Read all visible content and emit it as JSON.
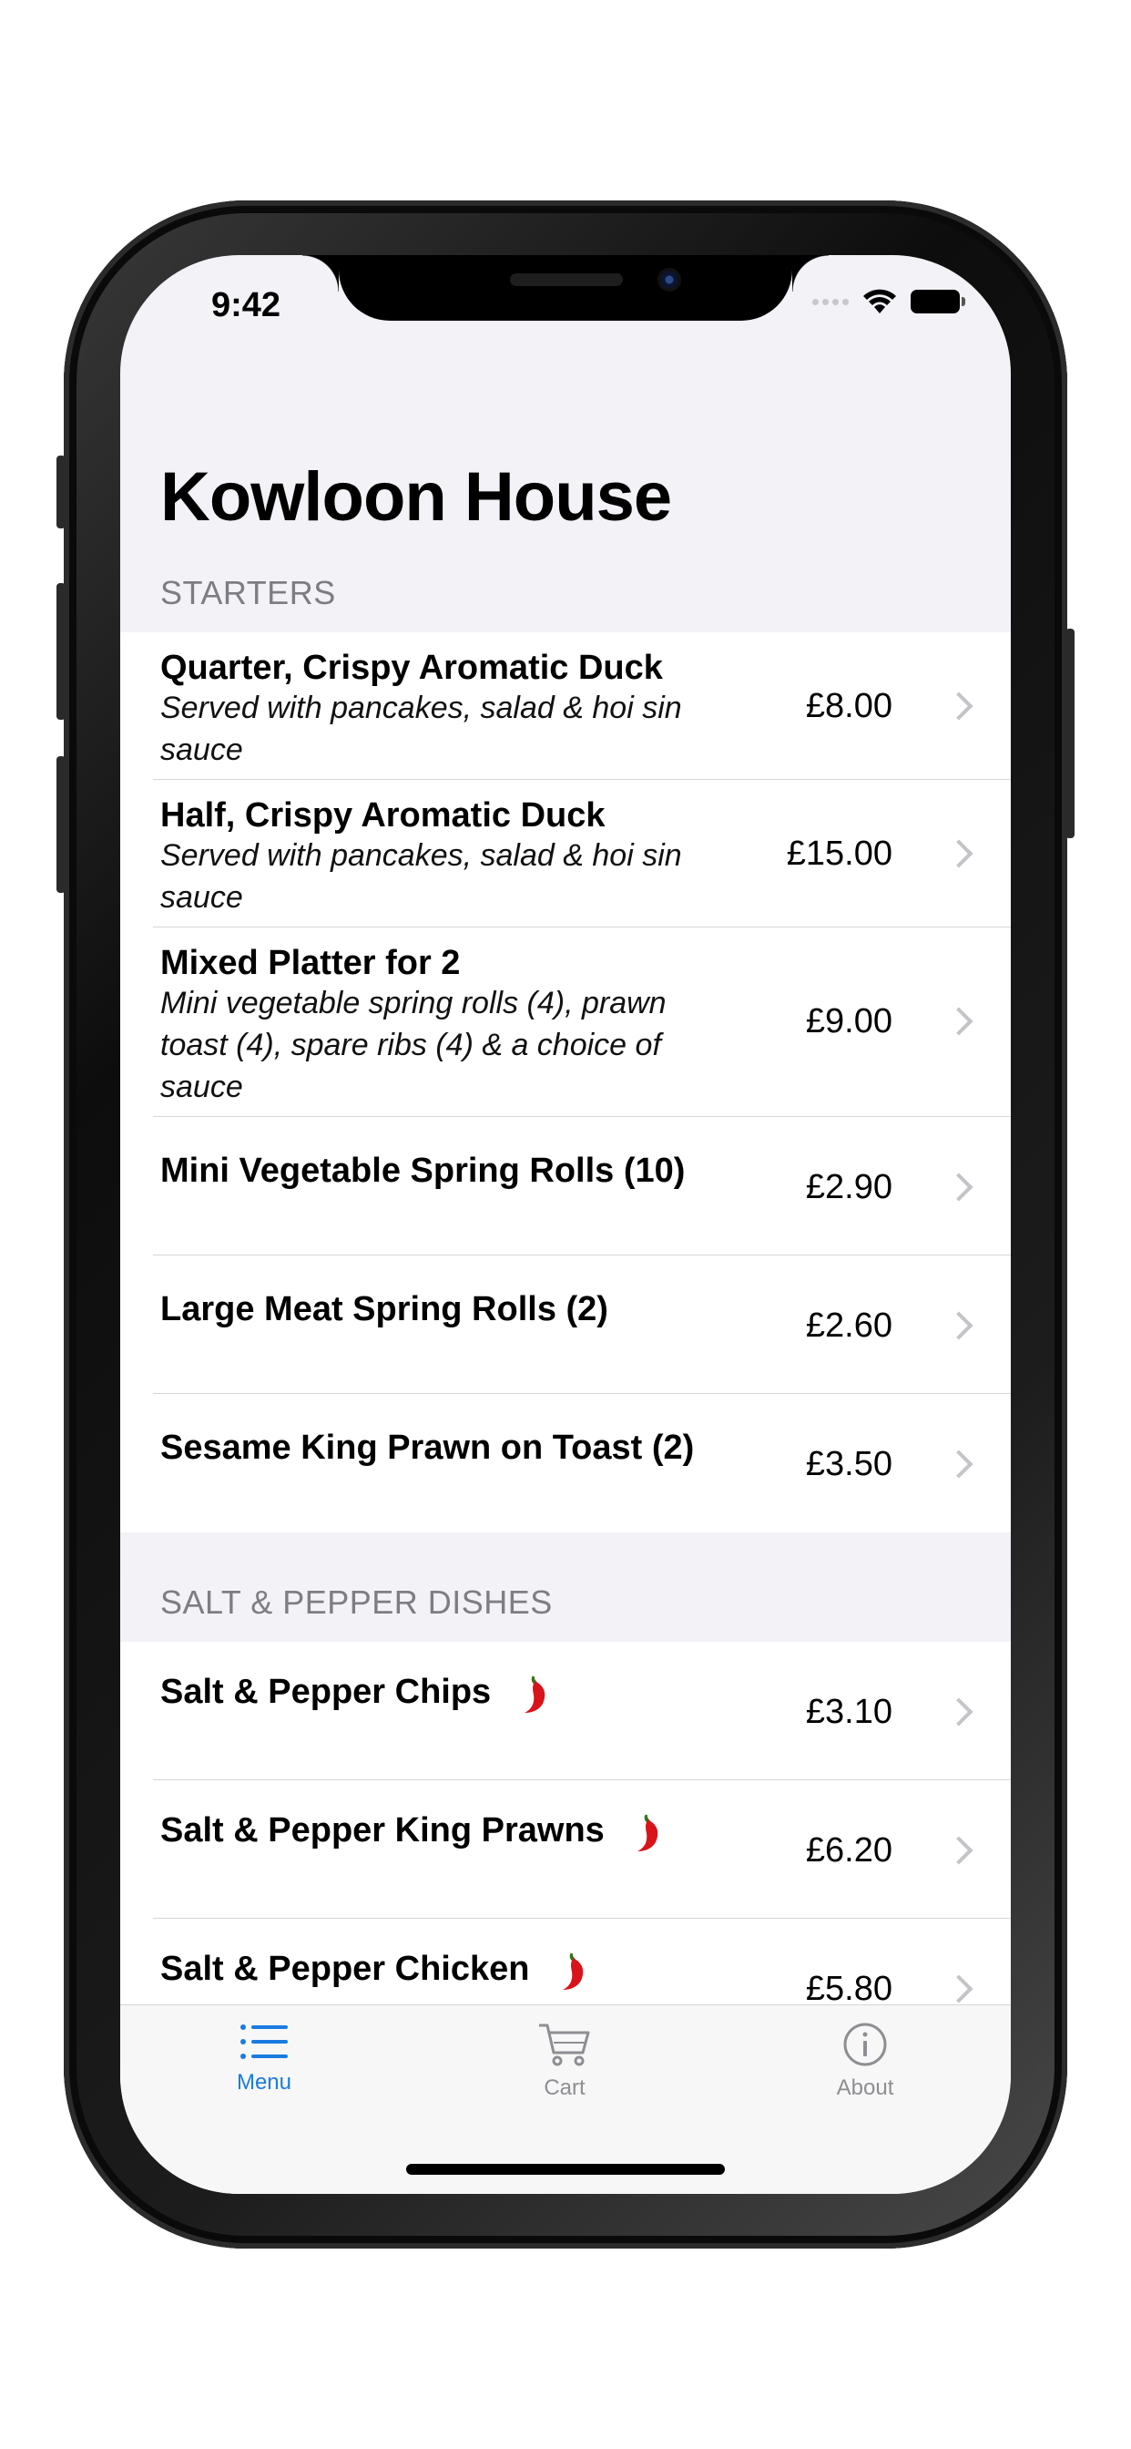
{
  "status": {
    "time": "9:42"
  },
  "title": "Kowloon House",
  "sections": [
    {
      "header": "STARTERS",
      "items": [
        {
          "name": "Quarter, Crispy Aromatic Duck",
          "description": "Served with pancakes, salad & hoi sin sauce",
          "price": "£8.00"
        },
        {
          "name": "Half, Crispy Aromatic Duck",
          "description": "Served with pancakes, salad & hoi sin sauce",
          "price": "£15.00"
        },
        {
          "name": "Mixed Platter for 2",
          "description": "Mini vegetable spring rolls (4), prawn toast (4), spare ribs (4) & a choice of sauce",
          "price": "£9.00"
        },
        {
          "name": "Mini Vegetable Spring Rolls (10)",
          "description": "",
          "price": "£2.90"
        },
        {
          "name": "Large Meat Spring Rolls (2)",
          "description": "",
          "price": "£2.60"
        },
        {
          "name": "Sesame King Prawn on Toast (2)",
          "description": "",
          "price": "£3.50"
        }
      ]
    },
    {
      "header": "SALT & PEPPER DISHES",
      "items": [
        {
          "name": "Salt & Pepper Chips",
          "description": "",
          "price": "£3.10",
          "icon": "chili-pepper-icon"
        },
        {
          "name": "Salt & Pepper King Prawns",
          "description": "",
          "price": "£6.20",
          "icon": "chili-pepper-icon"
        },
        {
          "name": "Salt & Pepper Chicken",
          "description": "",
          "price": "£5.80",
          "icon": "chili-pepper-icon"
        }
      ]
    }
  ],
  "tabs": [
    {
      "label": "Menu",
      "icon": "list-icon",
      "active": true
    },
    {
      "label": "Cart",
      "icon": "cart-icon",
      "active": false
    },
    {
      "label": "About",
      "icon": "info-icon",
      "active": false
    }
  ],
  "colors": {
    "accent": "#1a7be0",
    "inactive": "#8e8e93",
    "chili": "#d8131a"
  }
}
